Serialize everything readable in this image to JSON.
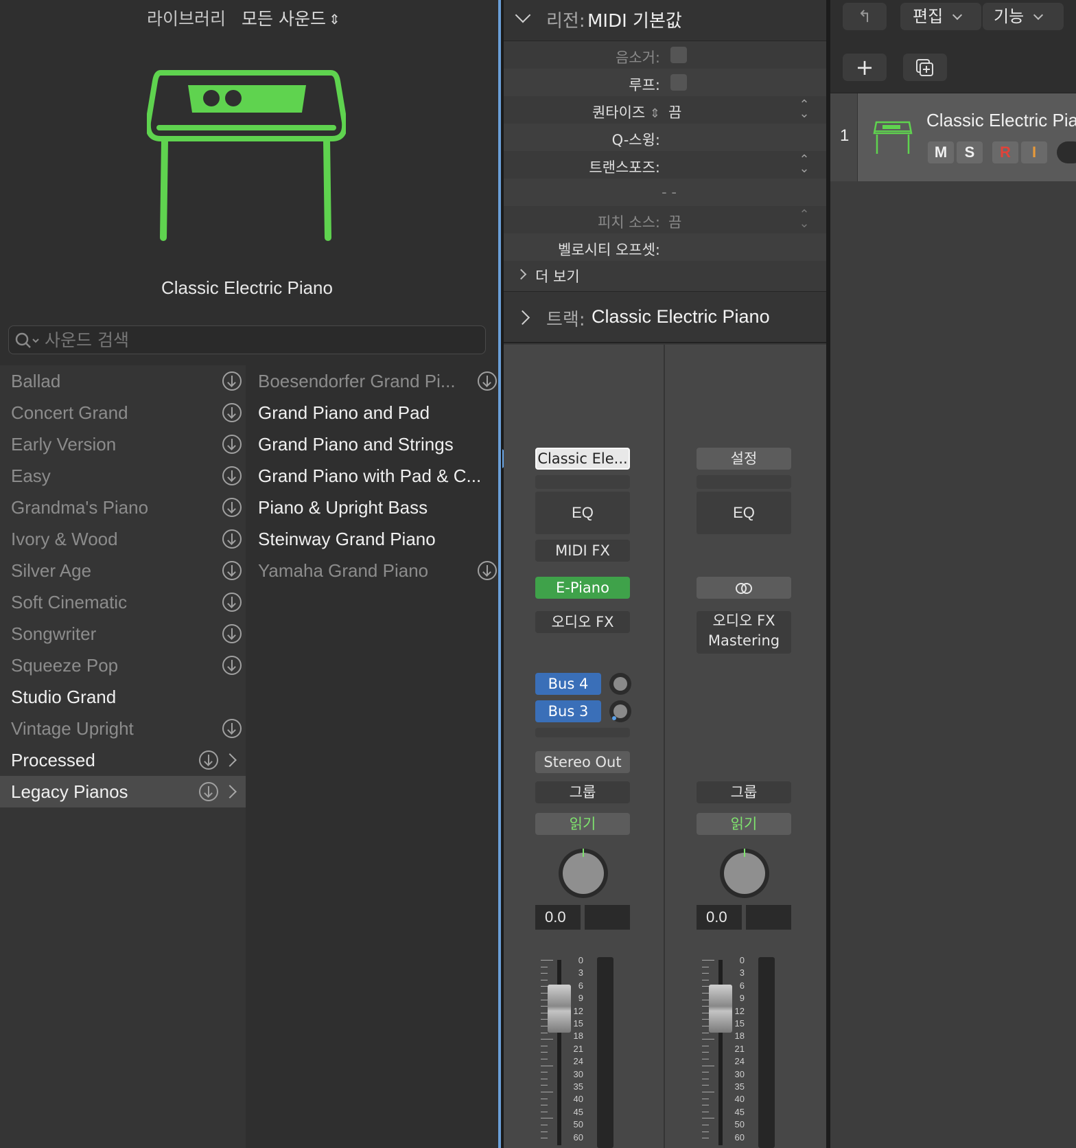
{
  "library": {
    "title": "라이브러리",
    "filter_label": "모든 사운드",
    "filter_arrows": "⌃⌄",
    "patch_name": "Classic Electric Piano",
    "search_placeholder": "사운드 검색",
    "categories": [
      {
        "label": "Ballad",
        "style": "dim",
        "download": true,
        "chevron": false
      },
      {
        "label": "Concert Grand",
        "style": "dim",
        "download": true,
        "chevron": false
      },
      {
        "label": "Early Version",
        "style": "dim",
        "download": true,
        "chevron": false
      },
      {
        "label": "Easy",
        "style": "dim",
        "download": true,
        "chevron": false
      },
      {
        "label": "Grandma's Piano",
        "style": "dim",
        "download": true,
        "chevron": false
      },
      {
        "label": "Ivory & Wood",
        "style": "dim",
        "download": true,
        "chevron": false
      },
      {
        "label": "Silver Age",
        "style": "dim",
        "download": true,
        "chevron": false
      },
      {
        "label": "Soft Cinematic",
        "style": "dim",
        "download": true,
        "chevron": false
      },
      {
        "label": "Songwriter",
        "style": "dim",
        "download": true,
        "chevron": false
      },
      {
        "label": "Squeeze Pop",
        "style": "dim",
        "download": true,
        "chevron": false
      },
      {
        "label": "Studio Grand",
        "style": "bright",
        "download": false,
        "chevron": false
      },
      {
        "label": "Vintage Upright",
        "style": "dim",
        "download": true,
        "chevron": false
      },
      {
        "label": "Processed",
        "style": "bright",
        "download": true,
        "chevron": true
      },
      {
        "label": "Legacy Pianos",
        "style": "bright",
        "download": true,
        "chevron": true,
        "selected": true
      }
    ],
    "patches": [
      {
        "label": "Boesendorfer Grand Pi...",
        "style": "dim",
        "download": true
      },
      {
        "label": "Grand Piano and Pad",
        "style": "bright",
        "download": false
      },
      {
        "label": "Grand Piano and Strings",
        "style": "bright",
        "download": false
      },
      {
        "label": "Grand Piano with Pad & C...",
        "style": "bright",
        "download": false
      },
      {
        "label": "Piano & Upright Bass",
        "style": "bright",
        "download": false
      },
      {
        "label": "Steinway Grand Piano",
        "style": "bright",
        "download": false
      },
      {
        "label": "Yamaha Grand Piano",
        "style": "dim",
        "download": true
      }
    ]
  },
  "inspector": {
    "region_label": "리전:",
    "region_value": "MIDI 기본값",
    "params": {
      "mute": "음소거:",
      "loop": "루프:",
      "quantize_label": "퀀타이즈",
      "quantize_value": "끔",
      "q_swing": "Q-스윙:",
      "transpose": "트랜스포즈:",
      "dashes": "- -",
      "pitch_source_label": "피치 소스:",
      "pitch_source_value": "끔",
      "velocity_offset": "벨로시티 오프셋:",
      "more": "더 보기"
    },
    "track_label": "트랙:",
    "track_value": "Classic Electric Piano"
  },
  "channel_strip_a": {
    "plugin": "Classic Ele...",
    "eq": "EQ",
    "midi_fx": "MIDI FX",
    "instrument": "E-Piano",
    "audio_fx": "오디오 FX",
    "sends": [
      "Bus 4",
      "Bus 3"
    ],
    "output": "Stereo Out",
    "group": "그룹",
    "automation": "읽기",
    "volume": "0.0",
    "scale": [
      "0",
      "3",
      "6",
      "9",
      "12",
      "15",
      "18",
      "21",
      "24",
      "30",
      "35",
      "40",
      "45",
      "50",
      "60"
    ]
  },
  "channel_strip_b": {
    "settings": "설정",
    "eq": "EQ",
    "audio_fx": "오디오 FX",
    "mastering": "Mastering",
    "group": "그룹",
    "automation": "읽기",
    "volume": "0.0",
    "scale": [
      "0",
      "3",
      "6",
      "9",
      "12",
      "15",
      "18",
      "21",
      "24",
      "30",
      "35",
      "40",
      "45",
      "50",
      "60"
    ]
  },
  "tracks": {
    "toolbar": {
      "back_icon": "↰",
      "edit": "편집",
      "functions": "기능",
      "add": "+",
      "duplicate_icon": "duplicate-icon"
    },
    "track_number": "1",
    "track_name": "Classic Electric Pia",
    "mute": "M",
    "solo": "S",
    "record": "R",
    "input": "I"
  },
  "colors": {
    "accent_green": "#5fd34f",
    "selection_blue": "#3a6fb8",
    "record_red": "#e0433a",
    "input_orange": "#e89a3a"
  }
}
